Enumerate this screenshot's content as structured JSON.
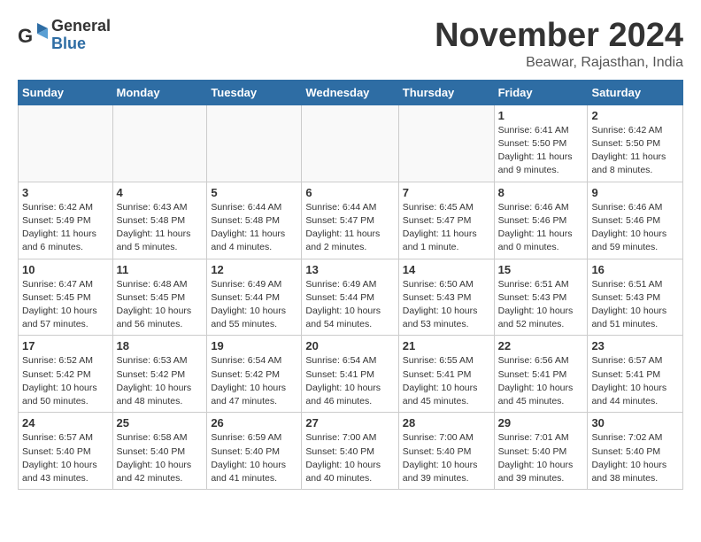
{
  "header": {
    "logo_general": "General",
    "logo_blue": "Blue",
    "month": "November 2024",
    "location": "Beawar, Rajasthan, India"
  },
  "weekdays": [
    "Sunday",
    "Monday",
    "Tuesday",
    "Wednesday",
    "Thursday",
    "Friday",
    "Saturday"
  ],
  "weeks": [
    [
      {
        "day": "",
        "empty": true
      },
      {
        "day": "",
        "empty": true
      },
      {
        "day": "",
        "empty": true
      },
      {
        "day": "",
        "empty": true
      },
      {
        "day": "",
        "empty": true
      },
      {
        "day": "1",
        "sunrise": "6:41 AM",
        "sunset": "5:50 PM",
        "daylight": "11 hours and 9 minutes."
      },
      {
        "day": "2",
        "sunrise": "6:42 AM",
        "sunset": "5:50 PM",
        "daylight": "11 hours and 8 minutes."
      }
    ],
    [
      {
        "day": "3",
        "sunrise": "6:42 AM",
        "sunset": "5:49 PM",
        "daylight": "11 hours and 6 minutes."
      },
      {
        "day": "4",
        "sunrise": "6:43 AM",
        "sunset": "5:48 PM",
        "daylight": "11 hours and 5 minutes."
      },
      {
        "day": "5",
        "sunrise": "6:44 AM",
        "sunset": "5:48 PM",
        "daylight": "11 hours and 4 minutes."
      },
      {
        "day": "6",
        "sunrise": "6:44 AM",
        "sunset": "5:47 PM",
        "daylight": "11 hours and 2 minutes."
      },
      {
        "day": "7",
        "sunrise": "6:45 AM",
        "sunset": "5:47 PM",
        "daylight": "11 hours and 1 minute."
      },
      {
        "day": "8",
        "sunrise": "6:46 AM",
        "sunset": "5:46 PM",
        "daylight": "11 hours and 0 minutes."
      },
      {
        "day": "9",
        "sunrise": "6:46 AM",
        "sunset": "5:46 PM",
        "daylight": "10 hours and 59 minutes."
      }
    ],
    [
      {
        "day": "10",
        "sunrise": "6:47 AM",
        "sunset": "5:45 PM",
        "daylight": "10 hours and 57 minutes."
      },
      {
        "day": "11",
        "sunrise": "6:48 AM",
        "sunset": "5:45 PM",
        "daylight": "10 hours and 56 minutes."
      },
      {
        "day": "12",
        "sunrise": "6:49 AM",
        "sunset": "5:44 PM",
        "daylight": "10 hours and 55 minutes."
      },
      {
        "day": "13",
        "sunrise": "6:49 AM",
        "sunset": "5:44 PM",
        "daylight": "10 hours and 54 minutes."
      },
      {
        "day": "14",
        "sunrise": "6:50 AM",
        "sunset": "5:43 PM",
        "daylight": "10 hours and 53 minutes."
      },
      {
        "day": "15",
        "sunrise": "6:51 AM",
        "sunset": "5:43 PM",
        "daylight": "10 hours and 52 minutes."
      },
      {
        "day": "16",
        "sunrise": "6:51 AM",
        "sunset": "5:43 PM",
        "daylight": "10 hours and 51 minutes."
      }
    ],
    [
      {
        "day": "17",
        "sunrise": "6:52 AM",
        "sunset": "5:42 PM",
        "daylight": "10 hours and 50 minutes."
      },
      {
        "day": "18",
        "sunrise": "6:53 AM",
        "sunset": "5:42 PM",
        "daylight": "10 hours and 48 minutes."
      },
      {
        "day": "19",
        "sunrise": "6:54 AM",
        "sunset": "5:42 PM",
        "daylight": "10 hours and 47 minutes."
      },
      {
        "day": "20",
        "sunrise": "6:54 AM",
        "sunset": "5:41 PM",
        "daylight": "10 hours and 46 minutes."
      },
      {
        "day": "21",
        "sunrise": "6:55 AM",
        "sunset": "5:41 PM",
        "daylight": "10 hours and 45 minutes."
      },
      {
        "day": "22",
        "sunrise": "6:56 AM",
        "sunset": "5:41 PM",
        "daylight": "10 hours and 45 minutes."
      },
      {
        "day": "23",
        "sunrise": "6:57 AM",
        "sunset": "5:41 PM",
        "daylight": "10 hours and 44 minutes."
      }
    ],
    [
      {
        "day": "24",
        "sunrise": "6:57 AM",
        "sunset": "5:40 PM",
        "daylight": "10 hours and 43 minutes."
      },
      {
        "day": "25",
        "sunrise": "6:58 AM",
        "sunset": "5:40 PM",
        "daylight": "10 hours and 42 minutes."
      },
      {
        "day": "26",
        "sunrise": "6:59 AM",
        "sunset": "5:40 PM",
        "daylight": "10 hours and 41 minutes."
      },
      {
        "day": "27",
        "sunrise": "7:00 AM",
        "sunset": "5:40 PM",
        "daylight": "10 hours and 40 minutes."
      },
      {
        "day": "28",
        "sunrise": "7:00 AM",
        "sunset": "5:40 PM",
        "daylight": "10 hours and 39 minutes."
      },
      {
        "day": "29",
        "sunrise": "7:01 AM",
        "sunset": "5:40 PM",
        "daylight": "10 hours and 39 minutes."
      },
      {
        "day": "30",
        "sunrise": "7:02 AM",
        "sunset": "5:40 PM",
        "daylight": "10 hours and 38 minutes."
      }
    ]
  ]
}
